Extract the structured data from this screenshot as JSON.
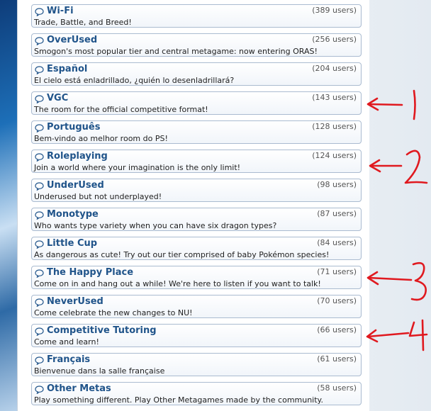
{
  "rooms": [
    {
      "name": "Wi-Fi",
      "users": "(389 users)",
      "desc": "Trade, Battle, and Breed!"
    },
    {
      "name": "OverUsed",
      "users": "(256 users)",
      "desc": "Smogon's most popular tier and central metagame: now entering ORAS!"
    },
    {
      "name": "Español",
      "users": "(204 users)",
      "desc": "El cielo está enladrillado, ¿quién lo desenladrillará?"
    },
    {
      "name": "VGC",
      "users": "(143 users)",
      "desc": "The room for the official competitive format!"
    },
    {
      "name": "Português",
      "users": "(128 users)",
      "desc": "Bem-vindo ao melhor room do PS!"
    },
    {
      "name": "Roleplaying",
      "users": "(124 users)",
      "desc": "Join a world where your imagination is the only limit!"
    },
    {
      "name": "UnderUsed",
      "users": "(98 users)",
      "desc": "Underused but not underplayed!"
    },
    {
      "name": "Monotype",
      "users": "(87 users)",
      "desc": "Who wants type variety when you can have six dragon types?"
    },
    {
      "name": "Little Cup",
      "users": "(84 users)",
      "desc": "As dangerous as cute! Try out our tier comprised of baby Pokémon species!"
    },
    {
      "name": "The Happy Place",
      "users": "(71 users)",
      "desc": "Come on in and hang out a while! We're here to listen if you want to talk!"
    },
    {
      "name": "NeverUsed",
      "users": "(70 users)",
      "desc": "Come celebrate the new changes to NU!"
    },
    {
      "name": "Competitive Tutoring",
      "users": "(66 users)",
      "desc": "Come and learn!"
    },
    {
      "name": "Français",
      "users": "(61 users)",
      "desc": "Bienvenue dans la salle française"
    },
    {
      "name": "Other Metas",
      "users": "(58 users)",
      "desc": "Play something different. Play Other Metagames made by the community."
    }
  ],
  "annotations": {
    "numbers": [
      "1",
      "2",
      "3",
      "4"
    ],
    "color": "#e0191f"
  },
  "colors": {
    "room_name": "#20548a",
    "room_border": "#aabbd0"
  },
  "icons": {
    "room": "chat-bubble-icon"
  }
}
